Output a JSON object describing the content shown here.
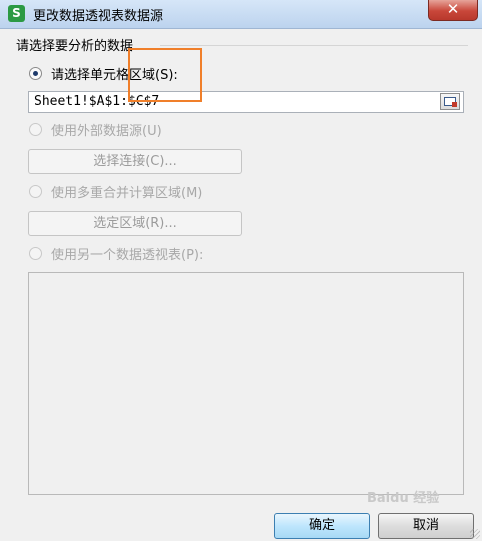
{
  "window": {
    "app_icon_letter": "S",
    "title": "更改数据透视表数据源",
    "close_icon": "close-icon",
    "close_glyph": "✕"
  },
  "group": {
    "legend": "请选择要分析的数据"
  },
  "options": {
    "cell_range": {
      "label": "请选择单元格区域(S):",
      "selected": true,
      "value": "Sheet1!$A$1:$C$7"
    },
    "external_source": {
      "label": "使用外部数据源(U)",
      "selected": false,
      "enabled": false,
      "button_label": "选择连接(C)..."
    },
    "consolidation": {
      "label": "使用多重合并计算区域(M)",
      "selected": false,
      "enabled": false,
      "button_label": "选定区域(R)..."
    },
    "another_pivot": {
      "label": "使用另一个数据透视表(P):",
      "selected": false,
      "enabled": false
    }
  },
  "buttons": {
    "ok": "确定",
    "cancel": "取消"
  },
  "watermark": "Baidu 经验",
  "colors": {
    "highlight": "#f07f2a",
    "titlebar": "#bcd3ee",
    "close": "#c9473a",
    "app_icon": "#2c9a44"
  }
}
